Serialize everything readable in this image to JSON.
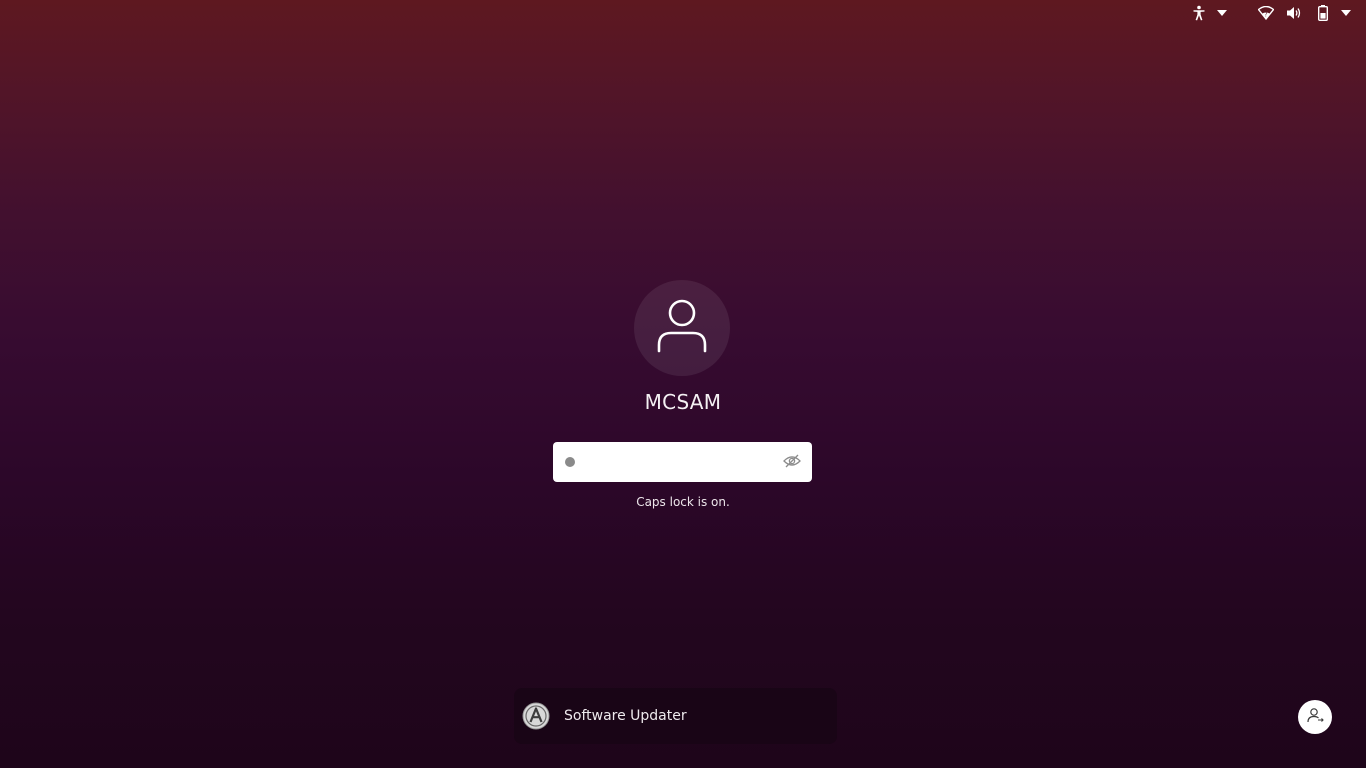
{
  "topbar": {
    "icons": {
      "accessibility": "accessibility-icon",
      "accessibility_menu": "chevron-down-icon",
      "network": "wifi-icon",
      "volume": "volume-icon",
      "battery": "battery-icon",
      "system_menu": "chevron-down-icon"
    }
  },
  "login": {
    "avatar_icon": "user-icon",
    "username": "MCSAM",
    "password": {
      "value": "",
      "placeholder": "",
      "reveal_icon": "eye-slash-icon"
    },
    "caps_lock_message": "Caps lock is on."
  },
  "notification": {
    "app_icon": "software-updater-icon",
    "title": "Software Updater"
  },
  "switch_user": {
    "icon": "switch-user-icon"
  },
  "colors": {
    "background_top": "#5e1820",
    "background_bottom": "#1e051a",
    "field_background": "#ffffff",
    "text": "#ffffff"
  }
}
